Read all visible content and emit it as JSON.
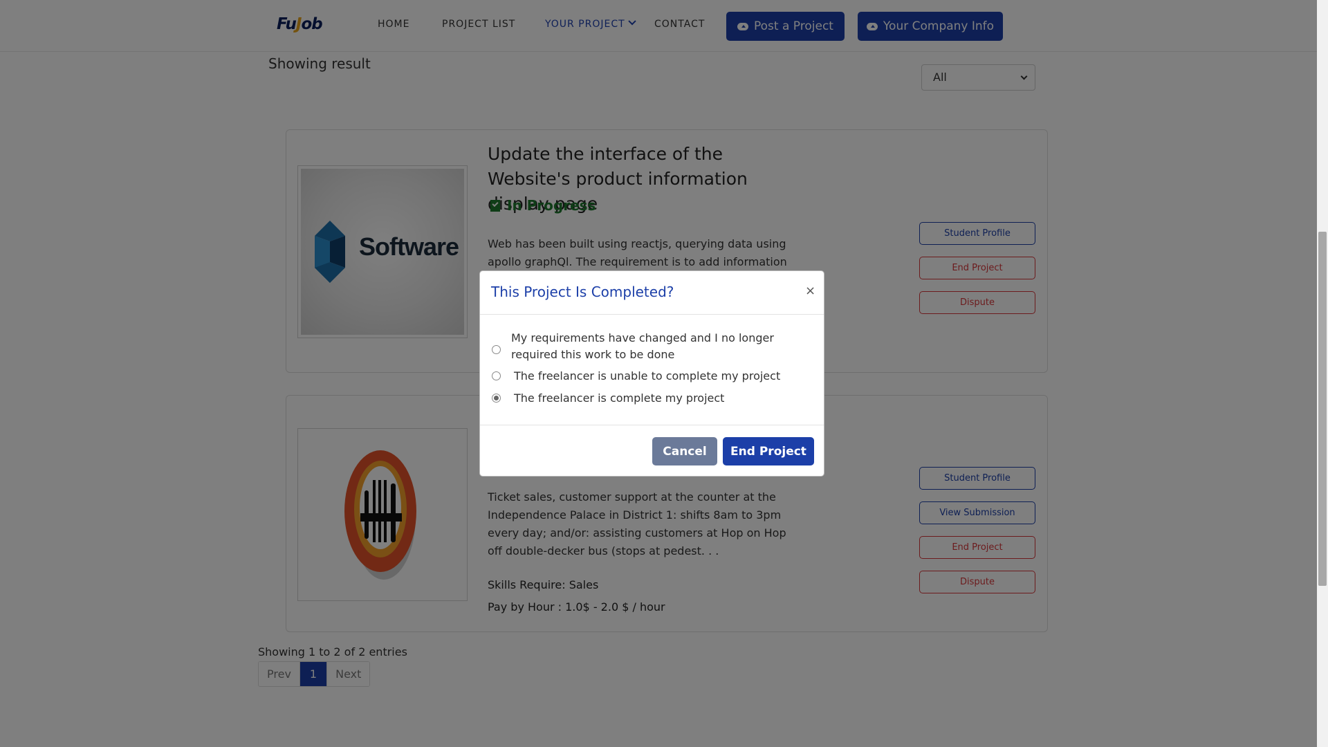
{
  "header": {
    "logo_prefix": "Fu",
    "logo_j": "J",
    "logo_suffix": "ob",
    "nav": [
      "HOME",
      "PROJECT LIST",
      "YOUR PROJECT",
      "CONTACT"
    ],
    "post_button": "Post a Project",
    "company_button": "Your Company Info"
  },
  "main": {
    "showing_result": "Showing result",
    "filter_value": "All"
  },
  "projects": [
    {
      "title": "Update the interface of the Website's product information display page",
      "status": "In Progress",
      "description": "Web has been built using reactjs, querying data using apollo graphQl. The requirement is to add information",
      "logo_text": "Software",
      "buttons": [
        "Student Profile",
        "End Project",
        "Dispute"
      ]
    },
    {
      "description": "Ticket sales, customer support at the counter at the Independence Palace in District 1: shifts 8am to 3pm every day; and/or: assisting customers at Hop on Hop off double-decker bus (stops at pedest. . .",
      "skills": "Skills Require: Sales",
      "pay": "Pay by Hour : 1.0$ - 2.0 $ / hour",
      "buttons": [
        "Student Profile",
        "View Submission",
        "End Project",
        "Dispute"
      ]
    }
  ],
  "pagination": {
    "summary": "Showing 1 to 2 of 2 entries",
    "prev": "Prev",
    "current": "1",
    "next": "Next"
  },
  "modal": {
    "title": "This Project Is Completed?",
    "close": "×",
    "options": [
      {
        "label": "My requirements have changed and I no longer required this work to be done",
        "checked": false
      },
      {
        "label": "The freelancer is unable to complete my project",
        "checked": false
      },
      {
        "label": "The freelancer is complete my project",
        "checked": true
      }
    ],
    "cancel": "Cancel",
    "confirm": "End Project"
  },
  "colors": {
    "brand": "#1c3fa8",
    "danger": "#d9373a",
    "success": "#1f7a2e"
  }
}
